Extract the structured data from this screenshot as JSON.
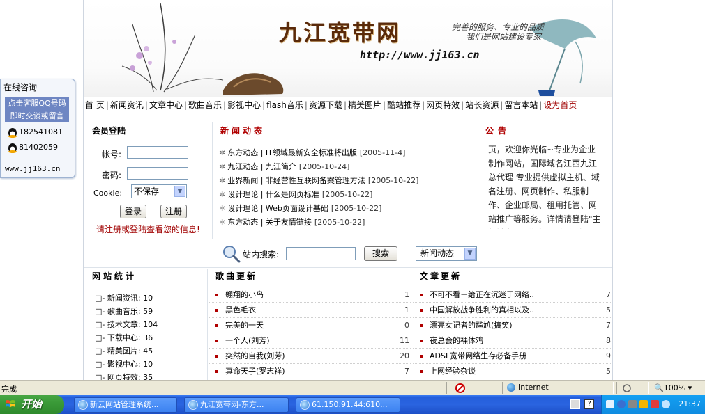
{
  "banner": {
    "site_title": "九江宽带网",
    "slogan_line1": "完善的服务、专业的品质",
    "slogan_line2": "我们是网站建设专家",
    "url": "http://www.jj163.cn"
  },
  "nav": {
    "items": [
      "首 页",
      "新闻资讯",
      "文章中心",
      "歌曲音乐",
      "影视中心",
      "flash音乐",
      "资源下载",
      "精美图片",
      "酷站推荐",
      "网页特效",
      "站长资源",
      "留言本站"
    ],
    "set_home": "设为首页",
    "separator": "|"
  },
  "member": {
    "title": "会员登陆",
    "account_label": "帐号:",
    "password_label": "密码:",
    "cookie_label": "Cookie:",
    "cookie_value": "不保存",
    "login_button": "登录",
    "register_button": "注册",
    "notice": "请注册或登陆查看您的信息!"
  },
  "news": {
    "title": "新闻动态",
    "items": [
      {
        "category": "东方动态",
        "title": "IT领域最新安全标准将出版",
        "date": "[2005-11-4]"
      },
      {
        "category": "九江动态",
        "title": "九江简介",
        "date": "[2005-10-24]"
      },
      {
        "category": "业界新闻",
        "title": "非经营性互联网备案管理方法",
        "date": "[2005-10-22]"
      },
      {
        "category": "设计理论",
        "title": "什么是网页标准",
        "date": "[2005-10-22]"
      },
      {
        "category": "设计理论",
        "title": "Web页面设计基础",
        "date": "[2005-10-22]"
      },
      {
        "category": "东方动态",
        "title": "关于友情链接",
        "date": "[2005-10-22]"
      }
    ]
  },
  "announcement": {
    "title": "公告",
    "text": "页，欢迎你光临~专业为企业制作网站，国际域名江西九江总代理 专业提供虚拟主机、域名注册、网页制作、私服制作、企业邮局、租用托管、网站推广等服务。详情请登陆\"主机域名\"，联系人：程剑锋"
  },
  "search": {
    "label": "站内搜索:",
    "button": "搜索",
    "category": "新闻动态"
  },
  "stats": {
    "title": "网站统计",
    "items": [
      {
        "label": "新闻资讯:",
        "count": "10"
      },
      {
        "label": "歌曲音乐:",
        "count": "59"
      },
      {
        "label": "技术文章:",
        "count": "104"
      },
      {
        "label": "下载中心:",
        "count": "36"
      },
      {
        "label": "精美图片:",
        "count": "45"
      },
      {
        "label": "影视中心:",
        "count": "10"
      },
      {
        "label": "网页特效:",
        "count": "35"
      }
    ]
  },
  "songs": {
    "title": "歌曲更新",
    "items": [
      {
        "title": "翱翔的小鸟",
        "count": "1"
      },
      {
        "title": "黑色毛衣",
        "count": "1"
      },
      {
        "title": "完美的一天",
        "count": "0"
      },
      {
        "title": "一个人(刘芳)",
        "count": "11"
      },
      {
        "title": "突然的自我(刘芳)",
        "count": "20"
      },
      {
        "title": "真命天子(罗志祥)",
        "count": "7"
      }
    ]
  },
  "articles": {
    "title": "文章更新",
    "items": [
      {
        "title": "不可不看－给正在沉迷于网络..",
        "count": "7"
      },
      {
        "title": "中国解放战争胜利的真相以及..",
        "count": "5"
      },
      {
        "title": "漂亮女记者的尴尬(搞笑)",
        "count": "7"
      },
      {
        "title": "夜总会的裸体鸡",
        "count": "8"
      },
      {
        "title": "ADSL宽带网络生存必备手册",
        "count": "9"
      },
      {
        "title": "上网经验杂谈",
        "count": "5"
      }
    ]
  },
  "qq_panel": {
    "title": "在线咨询",
    "prompt_line1": "点击客服QQ号码",
    "prompt_line2": "即时交谈或留言",
    "contacts": [
      "182541081",
      "81402059"
    ],
    "url": "www.jj163.cn"
  },
  "statusbar": {
    "status": "完成",
    "zone": "Internet",
    "zoom": "100%"
  },
  "taskbar": {
    "start": "开始",
    "tasks": [
      "新云网站管理系统...",
      "九江宽带网-东方...",
      "61.150.91.44:610..."
    ],
    "clock": "21:37"
  },
  "colors": {
    "accent_red": "#b00000",
    "qq_blue": "#6e86c3",
    "taskbar_blue": "#245edb",
    "start_green": "#3a9a38"
  }
}
